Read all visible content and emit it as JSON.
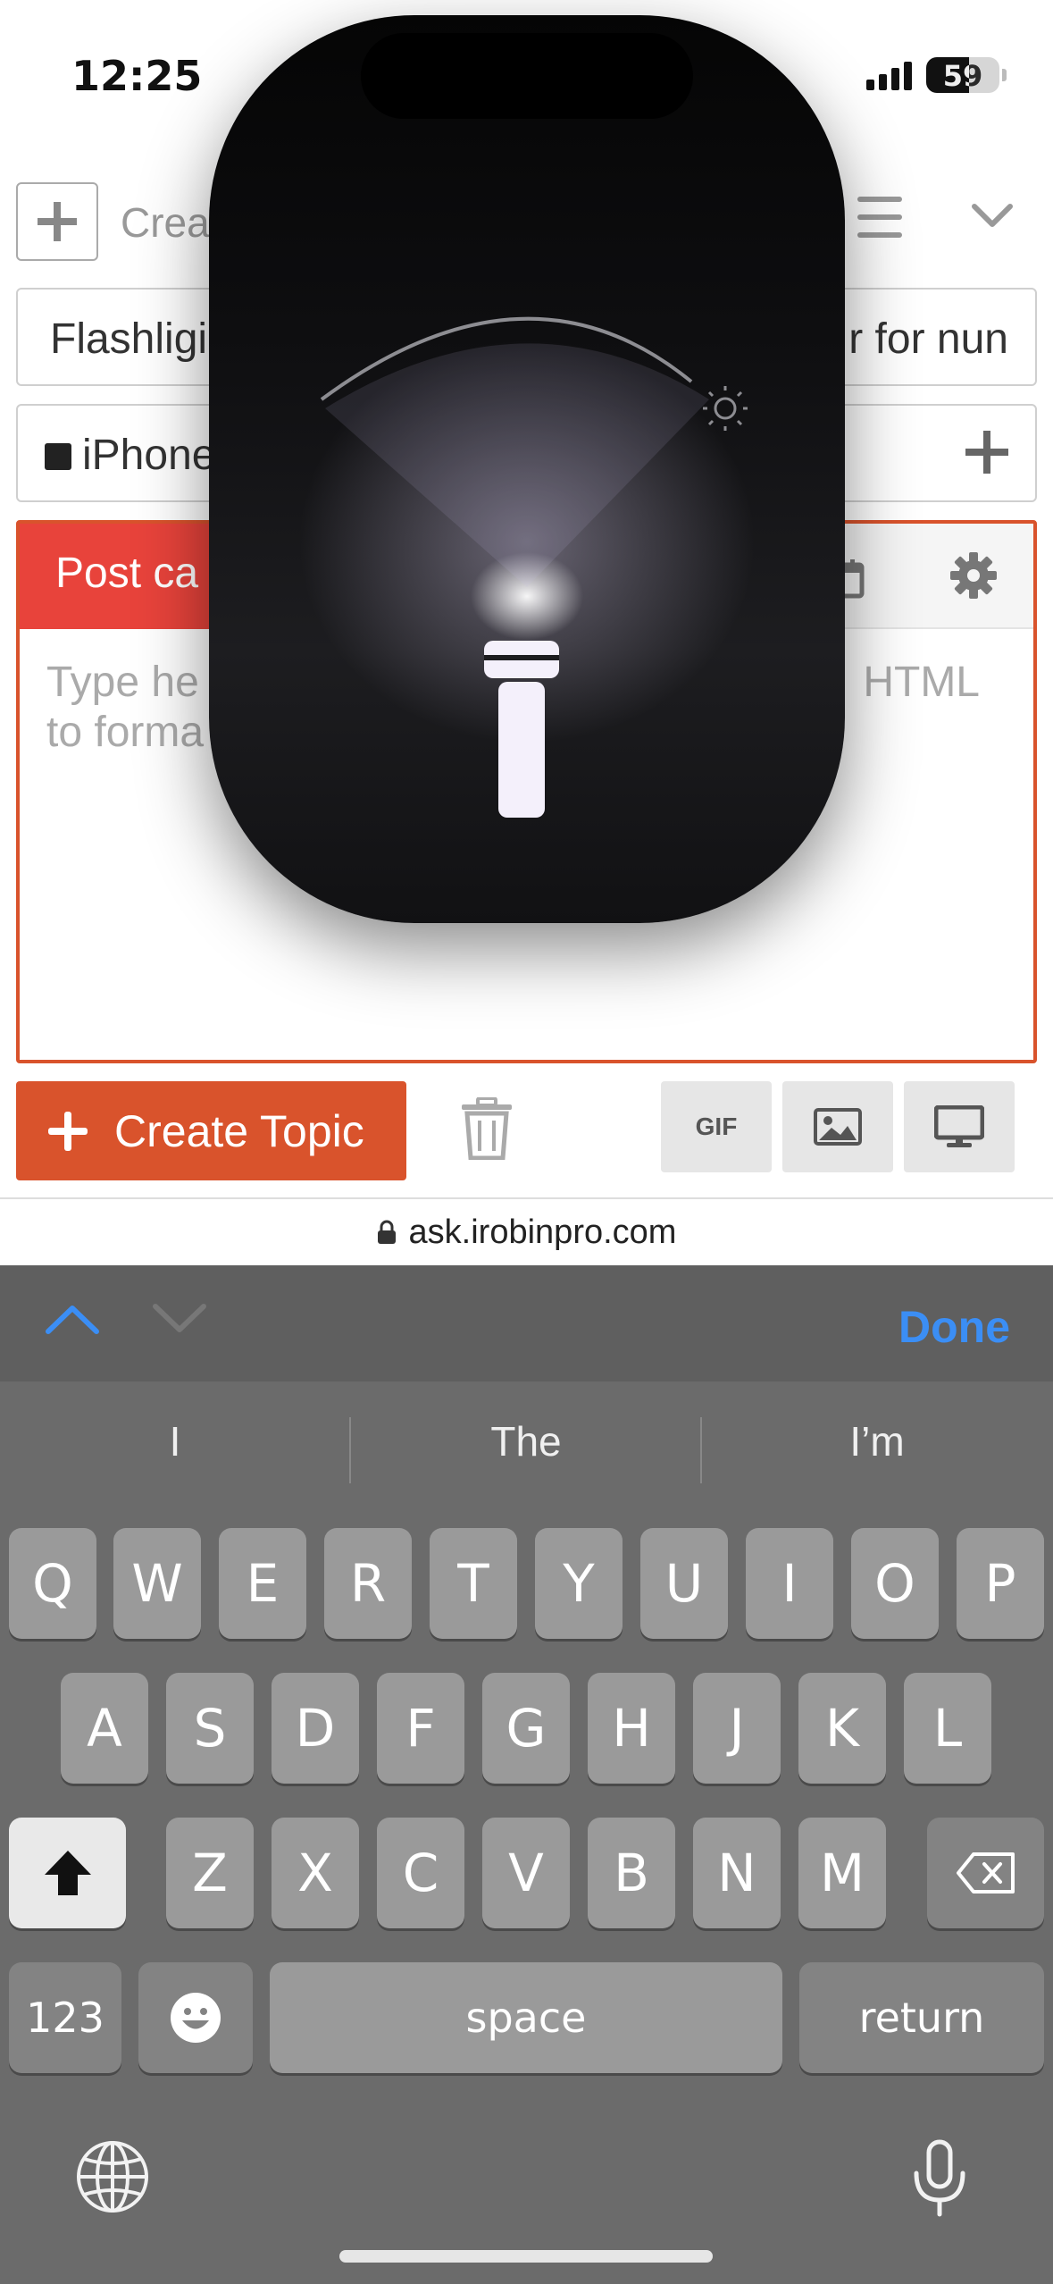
{
  "status_bar": {
    "time": "12:25",
    "battery": "59",
    "battery_level": 0.59
  },
  "composer": {
    "create_label": "Crea",
    "title_left": "Flashligi",
    "title_right": "r for nun",
    "category_left": "iPhone",
    "tab_active": "Post ca",
    "placeholder_line1": "Type he",
    "placeholder_line2": "to forma",
    "placeholder_right": "HTML",
    "create_topic": "Create Topic",
    "gif_label": "GIF"
  },
  "url_bar": {
    "url": "ask.irobinpro.com"
  },
  "keyboard": {
    "done": "Done",
    "suggestions": [
      "I",
      "The",
      "I’m"
    ],
    "row1": [
      "Q",
      "W",
      "E",
      "R",
      "T",
      "Y",
      "U",
      "I",
      "O",
      "P"
    ],
    "row2": [
      "A",
      "S",
      "D",
      "F",
      "G",
      "H",
      "J",
      "K",
      "L"
    ],
    "row3": [
      "Z",
      "X",
      "C",
      "V",
      "B",
      "N",
      "M"
    ],
    "numbers": "123",
    "space": "space",
    "return": "return"
  },
  "colors": {
    "accent": "#d9532c",
    "tab_red": "#e8433b",
    "done_blue": "#3b8ef5"
  }
}
